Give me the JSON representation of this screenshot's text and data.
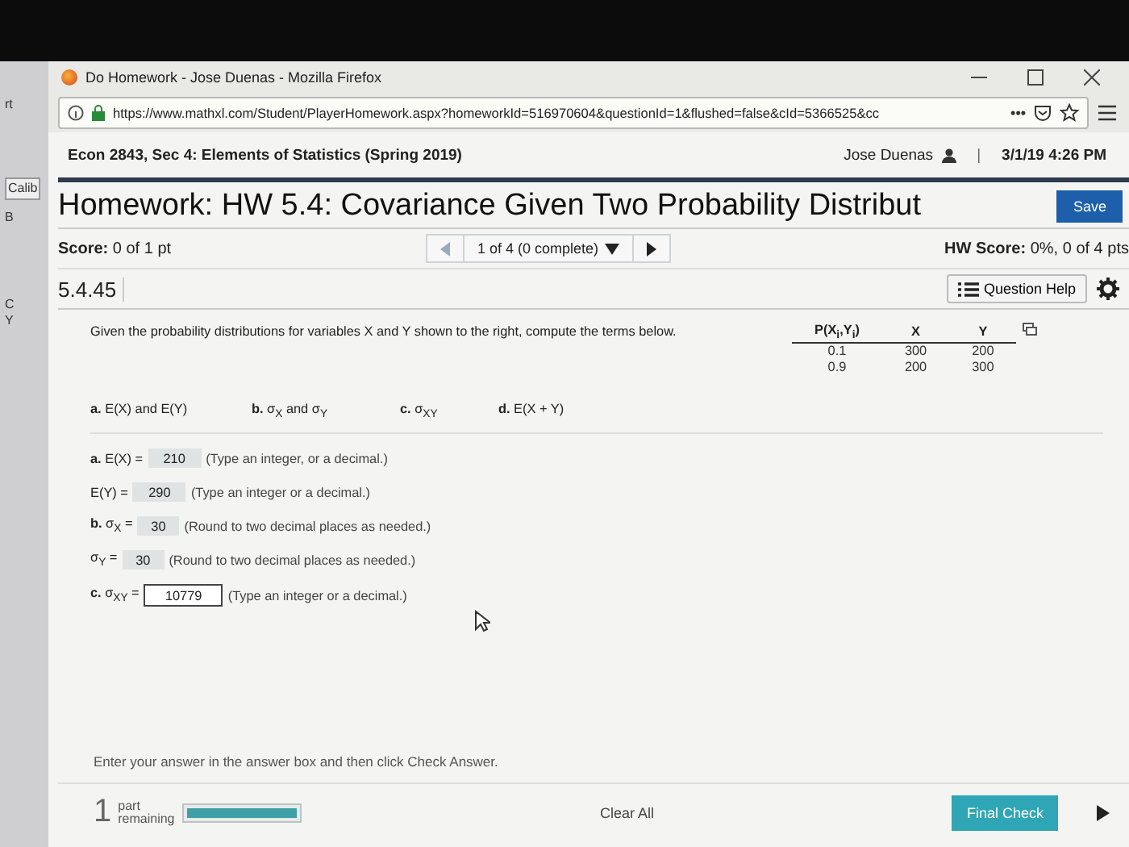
{
  "background_app": {
    "texts": [
      "rt",
      "Calib",
      "B",
      "C",
      "Y"
    ]
  },
  "window": {
    "title": "Do Homework - Jose Duenas - Mozilla Firefox"
  },
  "address_bar": {
    "url": "https://www.mathxl.com/Student/PlayerHomework.aspx?homeworkId=516970604&questionId=1&flushed=false&cId=5366525&cc",
    "more": "•••"
  },
  "header": {
    "course": "Econ 2843, Sec 4: Elements of Statistics (Spring 2019)",
    "user": "Jose Duenas",
    "separator": "|",
    "datetime": "3/1/19 4:26 PM"
  },
  "homework": {
    "title": "Homework: HW 5.4: Covariance Given Two Probability Distribut",
    "save": "Save"
  },
  "score_bar": {
    "score_label": "Score:",
    "score": "0 of 1 pt",
    "progress": "1 of 4 (0 complete)",
    "hw_score_label": "HW Score:",
    "hw_score": "0%, 0 of 4 pts"
  },
  "question": {
    "number": "5.4.45",
    "help": "Question Help"
  },
  "prompt": "Given the probability distributions for variables X and Y shown to the right, compute the terms below.",
  "table": {
    "columns": [
      "P(X$_{i}$,Y$_{i}$)",
      "X",
      "Y"
    ],
    "rows": [
      [
        "0.1",
        "300",
        "200"
      ],
      [
        "0.9",
        "200",
        "300"
      ]
    ]
  },
  "parts": [
    "**a.** E(X) and E(Y)",
    "**b.** σ$_{X}$ and σ$_{Y}$",
    "**c.** σ$_{XY}$",
    "**d.** E(X + Y)"
  ],
  "answers": [
    {
      "label": "**a.** E(X) =",
      "value": "210",
      "hint": "(Type an integer, or a decimal.)",
      "focused": false
    },
    {
      "label": "E(Y) =",
      "value": "290",
      "hint": "(Type an integer or a decimal.)",
      "focused": false
    },
    {
      "label": "**b.** σ$_{X}$ =",
      "value": "30",
      "hint": "(Round to two decimal places as needed.)",
      "focused": false
    },
    {
      "label": "σ$_{Y}$ =",
      "value": "30",
      "hint": "(Round to two decimal places as needed.)",
      "focused": false
    },
    {
      "label": "**c.** σ$_{XY}$ =",
      "value": "10779",
      "hint": "(Type an integer or a decimal.)",
      "focused": true
    }
  ],
  "instruction": "Enter your answer in the answer box and then click Check Answer.",
  "footer": {
    "count": "1",
    "count_label": "part remaining",
    "level": 1,
    "clear": "Clear All",
    "final": "Final Check"
  }
}
